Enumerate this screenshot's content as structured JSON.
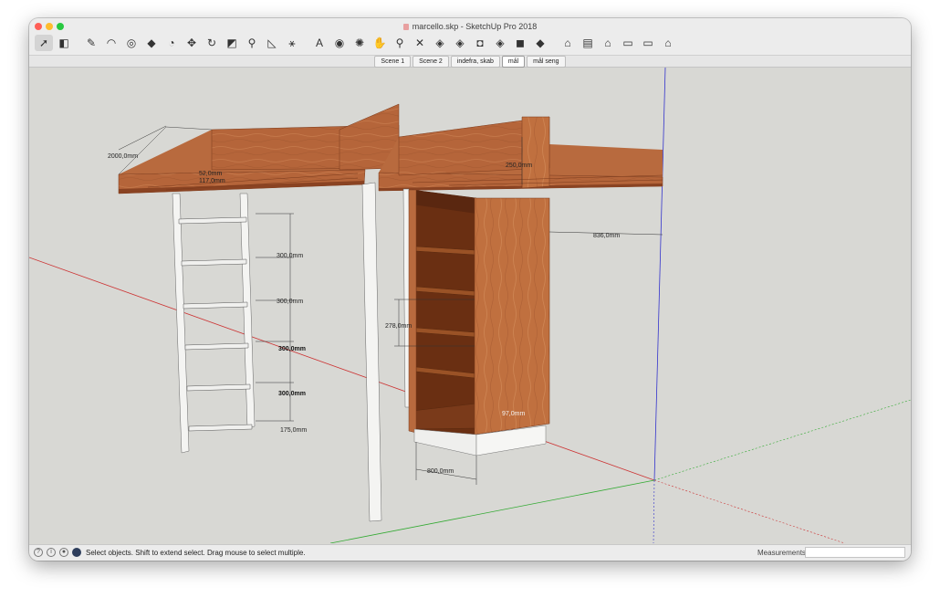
{
  "window": {
    "title": "marcello.skp - SketchUp Pro 2018"
  },
  "toolbar": {
    "tools": [
      {
        "name": "select-tool",
        "glyph": "➚"
      },
      {
        "name": "eraser-tool",
        "glyph": "◧"
      },
      {
        "name": "line-tool",
        "glyph": "✎"
      },
      {
        "name": "arc-tool",
        "glyph": "◠"
      },
      {
        "name": "shape-tool",
        "glyph": "◎"
      },
      {
        "name": "push-pull-tool",
        "glyph": "◆"
      },
      {
        "name": "offset-tool",
        "glyph": "◔"
      },
      {
        "name": "move-tool",
        "glyph": "✥"
      },
      {
        "name": "rotate-tool",
        "glyph": "↻"
      },
      {
        "name": "scale-tool",
        "glyph": "◩"
      },
      {
        "name": "tape-measure-tool",
        "glyph": "⚲"
      },
      {
        "name": "protractor-tool",
        "glyph": "◺"
      },
      {
        "name": "axes-tool",
        "glyph": "⚹"
      },
      {
        "name": "text-tool",
        "glyph": "A"
      },
      {
        "name": "paint-bucket-tool",
        "glyph": "◉"
      },
      {
        "name": "orbit-tool",
        "glyph": "✺"
      },
      {
        "name": "pan-tool",
        "glyph": "✋"
      },
      {
        "name": "zoom-tool",
        "glyph": "⚲"
      },
      {
        "name": "zoom-extents-tool",
        "glyph": "✕"
      },
      {
        "name": "warehouse-tool",
        "glyph": "◈"
      },
      {
        "name": "share-model-tool",
        "glyph": "◈"
      },
      {
        "name": "extension-warehouse-tool",
        "glyph": "◘"
      },
      {
        "name": "layout-tool",
        "glyph": "◈"
      },
      {
        "name": "extension-manager-tool",
        "glyph": "◼"
      },
      {
        "name": "styles-tool",
        "glyph": "◆"
      },
      {
        "name": "iso-view",
        "glyph": "⌂"
      },
      {
        "name": "top-view",
        "glyph": "▤"
      },
      {
        "name": "front-view",
        "glyph": "⌂"
      },
      {
        "name": "right-view",
        "glyph": "▭"
      },
      {
        "name": "back-view",
        "glyph": "▭"
      },
      {
        "name": "left-view",
        "glyph": "⌂"
      }
    ]
  },
  "scenes": [
    "Scene 1",
    "Scene 2",
    "indefra, skab",
    "mål",
    "mål seng"
  ],
  "active_scene": "mål",
  "dimensions": {
    "bed_width": "2000,0mm",
    "small_a": "52,0mm",
    "small_b": "117,0mm",
    "rung_1": "300,0mm",
    "rung_2": "300,0mm",
    "rung_3": "300,0mm",
    "rung_4": "300,0mm",
    "ladder_bottom": "175,0mm",
    "rail_height": "250,0mm",
    "overhang": "836,0mm",
    "shelf_gap": "278,0mm",
    "plinth": "97,0mm",
    "cabinet_width": "800,0mm"
  },
  "status": {
    "text": "Select objects. Shift to extend select. Drag mouse to select multiple.",
    "measurements_label": "Measurements",
    "measurements_value": ""
  },
  "colors": {
    "wood": "#b5653a",
    "wood_dark": "#8a4322",
    "background": "#d8d8d4",
    "axis_red": "#cc3333",
    "axis_green": "#33aa33",
    "axis_blue": "#3333cc"
  }
}
